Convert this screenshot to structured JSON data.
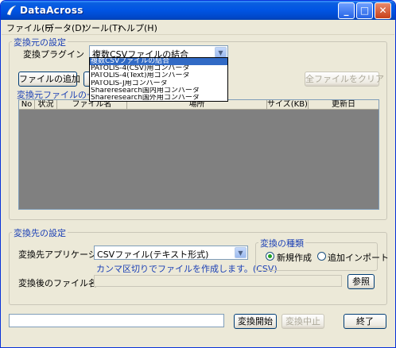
{
  "window": {
    "title": "DataAcross",
    "controls": {
      "minimize": "_",
      "maximize": "□",
      "close": "✕"
    }
  },
  "menu": [
    "ファイル(F)",
    "データ(D)",
    "ツール(T)",
    "ヘルプ(H)"
  ],
  "source_group": {
    "title": "変換元の設定",
    "plugin_label": "変換プラグイン",
    "plugin_selected": "複数CSVファイルの結合",
    "plugin_options": [
      "複数CSVファイルの結合",
      "PATOLIS-4(CSV)用コンバータ",
      "PATOLIS-4(Text)用コンバータ",
      "PATOLIS-J用コンバータ",
      "Shareresearch国内用コンバータ",
      "Shareresearch国外用コンバータ"
    ],
    "add_file_button": "ファイルの追加",
    "clear_all_button": "全ファイルをクリア",
    "file_list_title": "変換元ファイルの一覧",
    "columns": [
      "No",
      "状況",
      "ファイル名",
      "場所",
      "サイズ(KB)",
      "更新日"
    ]
  },
  "dest_group": {
    "title": "変換先の設定",
    "app_label": "変換先アプリケーション",
    "app_selected": "CSVファイル(テキスト形式)",
    "hint": "カンマ区切りでファイルを作成します。(CSV)",
    "kind_title": "変換の種類",
    "kind_options": [
      "新規作成",
      "追加インポート"
    ],
    "kind_selected_index": 0,
    "filename_label": "変換後のファイル名",
    "browse_button": "参照"
  },
  "footer": {
    "status_text": "",
    "start_button": "変換開始",
    "stop_button": "変換中止",
    "exit_button": "終了"
  }
}
